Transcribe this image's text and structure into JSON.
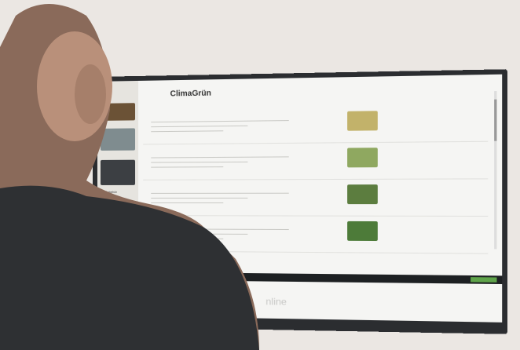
{
  "screen": {
    "brand": "ClimaGrün",
    "footer_word": "nline",
    "products": [
      {
        "thumb_color": "#c2b26a"
      },
      {
        "thumb_color": "#8fa860"
      },
      {
        "thumb_color": "#5c7d3f"
      },
      {
        "thumb_color": "#4d7b39"
      }
    ],
    "left_label": "Zubehör"
  }
}
